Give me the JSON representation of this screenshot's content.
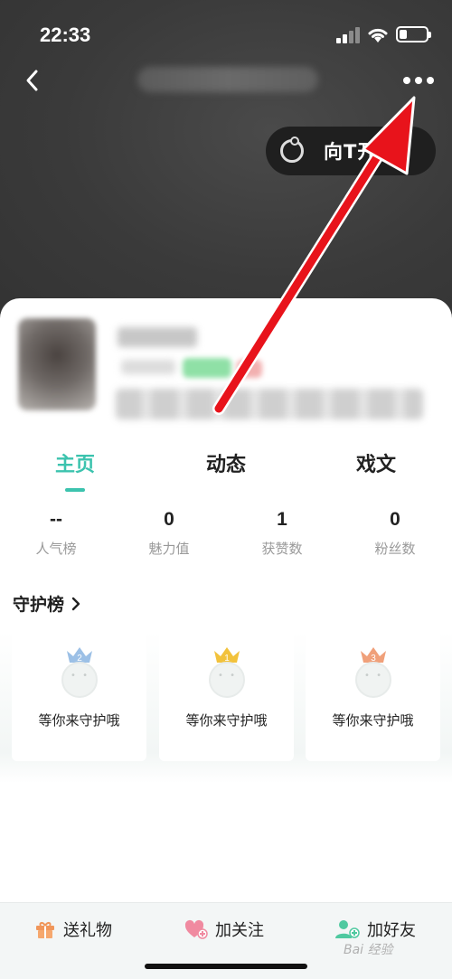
{
  "status": {
    "time": "22:33"
  },
  "header": {
    "live_label": "向T开播"
  },
  "tabs": [
    {
      "label": "主页",
      "active": true
    },
    {
      "label": "动态",
      "active": false
    },
    {
      "label": "戏文",
      "active": false
    }
  ],
  "stats": [
    {
      "value": "--",
      "label": "人气榜"
    },
    {
      "value": "0",
      "label": "魅力值"
    },
    {
      "value": "1",
      "label": "获赞数"
    },
    {
      "value": "0",
      "label": "粉丝数"
    }
  ],
  "guard": {
    "title": "守护榜",
    "cards": [
      {
        "rank": "2",
        "text": "等你来守护哦",
        "crown_color": "#9cc0e6"
      },
      {
        "rank": "1",
        "text": "等你来守护哦",
        "crown_color": "#f2c23c"
      },
      {
        "rank": "3",
        "text": "等你来守护哦",
        "crown_color": "#f0a07a"
      }
    ]
  },
  "bottom_bar": {
    "gift": "送礼物",
    "follow": "加关注",
    "friend": "加好友"
  },
  "watermark": "Bai 经验",
  "colors": {
    "accent": "#3cc3ae",
    "annotation_arrow": "#e8131b"
  }
}
